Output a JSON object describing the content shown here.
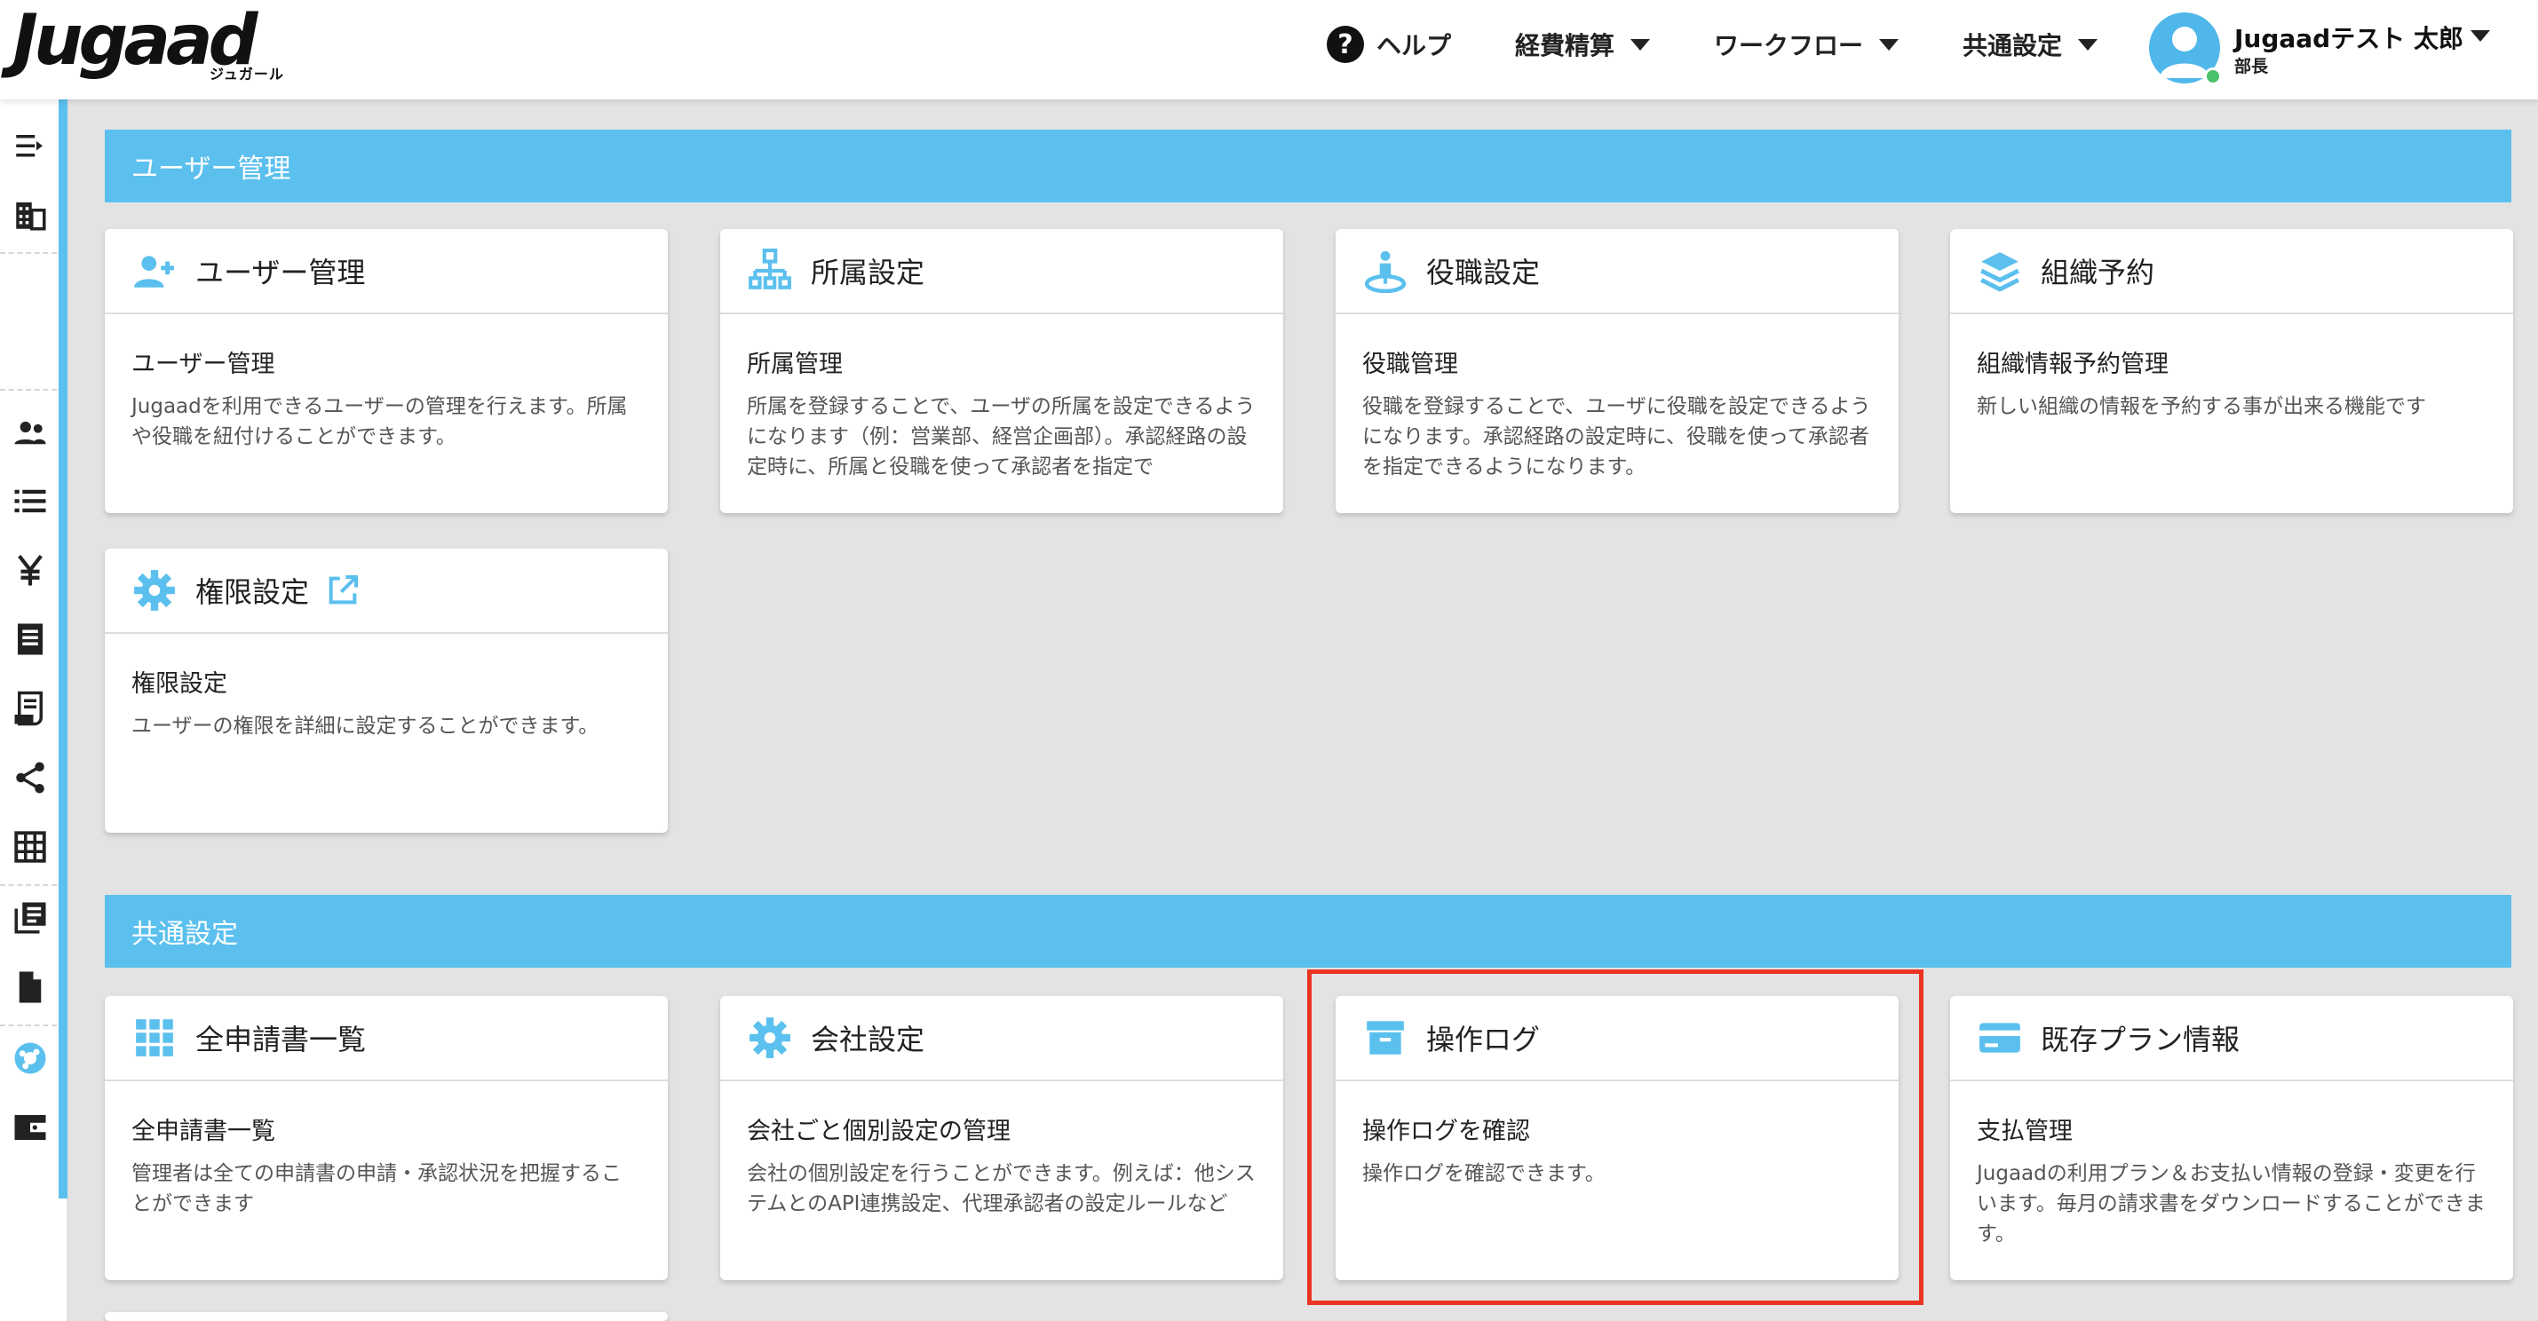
{
  "header": {
    "logo_text": "Jugaad",
    "logo_sub": "ジュガール",
    "help_label": "ヘルプ",
    "nav_expense": "経費精算",
    "nav_workflow": "ワークフロー",
    "nav_common": "共通設定",
    "user_name": "Jugaadテスト 太郎",
    "user_role": "部長"
  },
  "sections": [
    {
      "title": "ユーザー管理",
      "cards": [
        {
          "title": "ユーザー管理",
          "subtitle": "ユーザー管理",
          "description": "Jugaadを利用できるユーザーの管理を行えます。所属や役職を紐付けることができます。",
          "icon": "add-user-icon"
        },
        {
          "title": "所属設定",
          "subtitle": "所属管理",
          "description": "所属を登録することで、ユーザの所属を設定できるようになります（例：営業部、経営企画部）。承認経路の設定時に、所属と役職を使って承認者を指定で",
          "icon": "org-chart-icon"
        },
        {
          "title": "役職設定",
          "subtitle": "役職管理",
          "description": "役職を登録することで、ユーザに役職を設定できるようになります。承認経路の設定時に、役職を使って承認者を指定できるようになります。",
          "icon": "person-pin-icon"
        },
        {
          "title": "組織予約",
          "subtitle": "組織情報予約管理",
          "description": "新しい組織の情報を予約する事が出来る機能です",
          "icon": "layers-icon"
        },
        {
          "title": "権限設定",
          "subtitle": "権限設定",
          "description": "ユーザーの権限を詳細に設定することができます。",
          "icon": "gear-icon",
          "external": true
        }
      ]
    },
    {
      "title": "共通設定",
      "cards": [
        {
          "title": "全申請書一覧",
          "subtitle": "全申請書一覧",
          "description": "管理者は全ての申請書の申請・承認状況を把握することができます",
          "icon": "grid-icon"
        },
        {
          "title": "会社設定",
          "subtitle": "会社ごと個別設定の管理",
          "description": "会社の個別設定を行うことができます。例えば：他システムとのAPI連携設定、代理承認者の設定ルールなど",
          "icon": "gear-icon"
        },
        {
          "title": "操作ログ",
          "subtitle": "操作ログを確認",
          "description": "操作ログを確認できます。",
          "icon": "archive-icon"
        },
        {
          "title": "既存プラン情報",
          "subtitle": "支払管理",
          "description": "Jugaadの利用プラン＆お支払い情報の登録・変更を行います。毎月の請求書をダウンロードすることができます。",
          "icon": "credit-card-icon"
        }
      ]
    }
  ],
  "colors": {
    "accent": "#5bc0ee",
    "highlight": "#ea3323",
    "background": "#e3e3e3"
  }
}
